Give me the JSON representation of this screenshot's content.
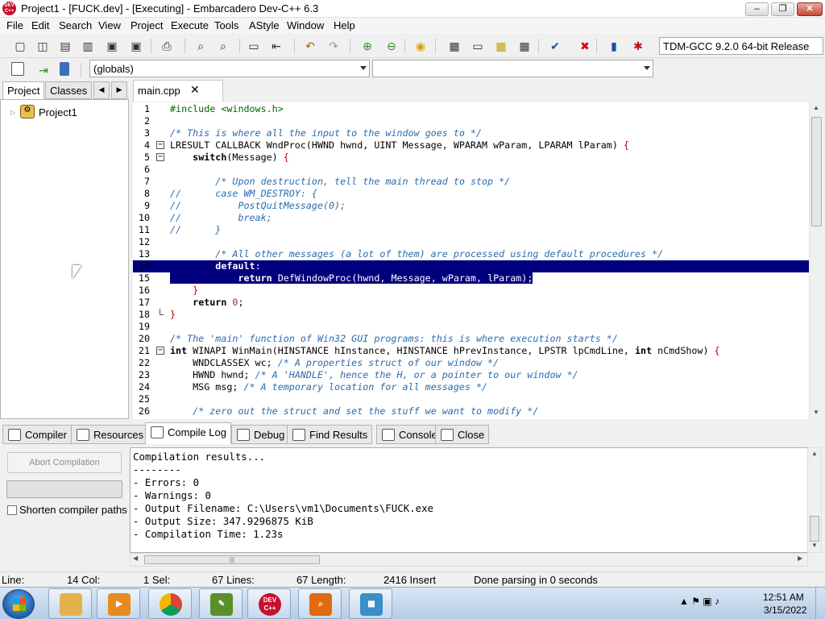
{
  "window": {
    "title": "Project1 - [FUCK.dev] - [Executing] - Embarcadero Dev-C++ 6.3",
    "logo_text": "DEV C++",
    "min": "–",
    "max": "❐",
    "close": "✕"
  },
  "menu": [
    "File",
    "Edit",
    "Search",
    "View",
    "Project",
    "Execute",
    "Tools",
    "AStyle",
    "Window",
    "Help"
  ],
  "toolbar": {
    "icons": [
      "new-file-icon",
      "open-icon",
      "save-icon",
      "save-all-icon",
      "close-icon",
      "close-all-icon",
      "print-icon",
      "find-icon",
      "replace-icon",
      "goto-icon",
      "bookmark-icon",
      "undo-icon",
      "redo-icon",
      "add-to-project-icon",
      "remove-from-project-icon",
      "project-options-icon",
      "compile-icon",
      "run-icon",
      "compile-run-icon",
      "rebuild-icon",
      "check-syntax-icon",
      "stop-icon",
      "profile-icon",
      "debug-icon"
    ],
    "compiler": "TDM-GCC 9.2.0 64-bit Release"
  },
  "toolbar2": {
    "scope": "(globals)",
    "members": ""
  },
  "left_panel": {
    "tabs": [
      "Project",
      "Classes"
    ],
    "tree": [
      {
        "label": "Project1",
        "expander": "▷"
      }
    ]
  },
  "editor": {
    "tab": "main.cpp",
    "tab_close": "✕",
    "lines": [
      {
        "n": "1",
        "parts": [
          [
            "pp",
            "#include <windows.h>"
          ]
        ]
      },
      {
        "n": "2",
        "parts": []
      },
      {
        "n": "3",
        "parts": [
          [
            "cm",
            "/* This is where all the input to the window goes to */"
          ]
        ]
      },
      {
        "n": "4",
        "fold": "minus",
        "parts": [
          [
            "",
            "LRESULT CALLBACK WndProc(HWND hwnd, UINT Message, WPARAM wParam, LPARAM lParam) "
          ],
          [
            "brc",
            "{"
          ]
        ]
      },
      {
        "n": "5",
        "fold": "minus",
        "parts": [
          [
            "",
            "    "
          ],
          [
            "kw",
            "switch"
          ],
          [
            "",
            "(Message) "
          ],
          [
            "brc",
            "{"
          ]
        ]
      },
      {
        "n": "6",
        "parts": []
      },
      {
        "n": "7",
        "parts": [
          [
            "",
            "        "
          ],
          [
            "cm",
            "/* Upon destruction, tell the main thread to stop */"
          ]
        ]
      },
      {
        "n": "8",
        "parts": [
          [
            "cm",
            "//      case WM_DESTROY: {"
          ]
        ]
      },
      {
        "n": "9",
        "parts": [
          [
            "cm",
            "//          PostQuitMessage(0);"
          ]
        ]
      },
      {
        "n": "10",
        "parts": [
          [
            "cm",
            "//          break;"
          ]
        ]
      },
      {
        "n": "11",
        "parts": [
          [
            "cm",
            "//      }"
          ]
        ]
      },
      {
        "n": "12",
        "parts": []
      },
      {
        "n": "13",
        "parts": [
          [
            "",
            "        "
          ],
          [
            "cm",
            "/* All other messages (a lot of them) are processed using default procedures */"
          ]
        ]
      },
      {
        "n": "14",
        "sel": "full",
        "parts": [
          [
            "",
            "        "
          ],
          [
            "kw",
            "default"
          ],
          [
            "",
            ":"
          ]
        ]
      },
      {
        "n": "15",
        "sel": "partial",
        "parts": [
          [
            "",
            "            "
          ],
          [
            "kw",
            "return"
          ],
          [
            "",
            " DefWindowProc(hwnd, Message, wParam, lParam);"
          ]
        ]
      },
      {
        "n": "16",
        "parts": [
          [
            "",
            "    "
          ],
          [
            "brc",
            "}"
          ]
        ]
      },
      {
        "n": "17",
        "parts": [
          [
            "",
            "    "
          ],
          [
            "kw",
            "return"
          ],
          [
            "nm",
            " 0"
          ],
          [
            "",
            ";"
          ]
        ]
      },
      {
        "n": "18",
        "fold": "end",
        "parts": [
          [
            "brc",
            "}"
          ]
        ]
      },
      {
        "n": "19",
        "parts": []
      },
      {
        "n": "20",
        "parts": [
          [
            "cm",
            "/* The 'main' function of Win32 GUI programs: this is where execution starts */"
          ]
        ]
      },
      {
        "n": "21",
        "fold": "minus",
        "parts": [
          [
            "kw",
            "int"
          ],
          [
            "",
            " WINAPI WinMain(HINSTANCE hInstance, HINSTANCE hPrevInstance, LPSTR lpCmdLine, "
          ],
          [
            "kw",
            "int"
          ],
          [
            "",
            " nCmdShow) "
          ],
          [
            "brc",
            "{"
          ]
        ]
      },
      {
        "n": "22",
        "parts": [
          [
            "",
            "    WNDCLASSEX wc; "
          ],
          [
            "cm",
            "/* A properties struct of our window */"
          ]
        ]
      },
      {
        "n": "23",
        "parts": [
          [
            "",
            "    HWND hwnd; "
          ],
          [
            "cm",
            "/* A 'HANDLE', hence the H, or a pointer to our window */"
          ]
        ]
      },
      {
        "n": "24",
        "parts": [
          [
            "",
            "    MSG msg; "
          ],
          [
            "cm",
            "/* A temporary location for all messages */"
          ]
        ]
      },
      {
        "n": "25",
        "parts": []
      },
      {
        "n": "26",
        "parts": [
          [
            "",
            "    "
          ],
          [
            "cm",
            "/* zero out the struct and set the stuff we want to modify */"
          ]
        ]
      }
    ]
  },
  "bottom_tabs": [
    "Compiler",
    "Resources",
    "Compile Log",
    "Debug",
    "Find Results",
    "Console",
    "Close"
  ],
  "bottom_tab_icons": [
    "compiler-tab-icon",
    "resources-tab-icon",
    "compile-log-tab-icon",
    "debug-tab-icon",
    "find-results-tab-icon",
    "console-tab-icon",
    "close-tab-icon"
  ],
  "compile_panel": {
    "abort_label": "Abort Compilation",
    "shorten_label": "Shorten compiler paths",
    "shorten_checked": false,
    "log": "Compilation results...\n--------\n- Errors: 0\n- Warnings: 0\n- Output Filename: C:\\Users\\vm1\\Documents\\FUCK.exe\n- Output Size: 347.9296875 KiB\n- Compilation Time: 1.23s"
  },
  "status": {
    "line_label": "Line:",
    "col": "14 Col:",
    "sel": "1 Sel:",
    "lines": "67 Lines:",
    "length": "67 Length:",
    "insert": "2416 Insert",
    "message": "Done parsing in 0 seconds"
  },
  "taskbar": {
    "apps": [
      {
        "name": "explorer",
        "label": "",
        "color": "#e3b24a"
      },
      {
        "name": "media-player",
        "label": "▶",
        "color": "#e88a1f"
      },
      {
        "name": "chrome",
        "label": "",
        "color": "#db4437"
      },
      {
        "name": "editor",
        "label": "✎",
        "color": "#5a8f2a"
      },
      {
        "name": "dev-cpp",
        "label": "DEV C++",
        "color": "#c8102e"
      },
      {
        "name": "search-app",
        "label": "⌕",
        "color": "#e06a12"
      },
      {
        "name": "cubes-app",
        "label": "▦",
        "color": "#3a8fc7"
      }
    ],
    "time": "12:51 AM",
    "date": "3/15/2022",
    "tray": "▲  ⚑  ▣  ♪"
  },
  "colors": {
    "selection": "#00007e",
    "comment": "#2b6cb0",
    "preprocessor": "#006400",
    "brace": "#c00000"
  }
}
